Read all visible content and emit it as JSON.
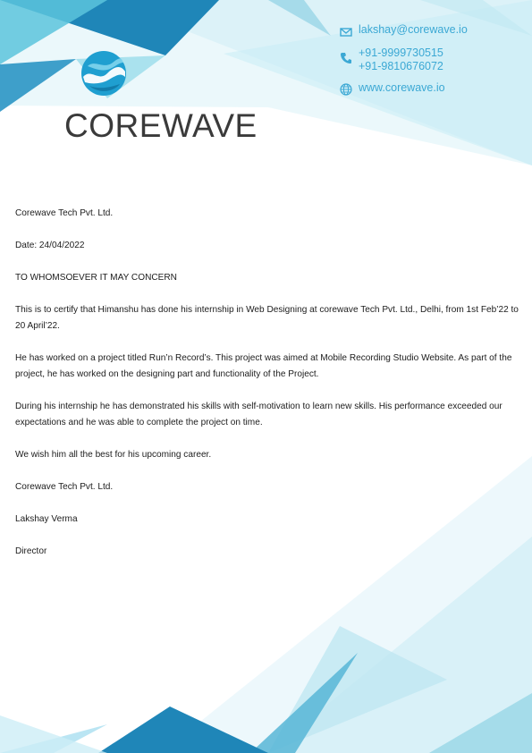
{
  "brand": {
    "name": "COREWAVE",
    "logo_icon": "wave-globe-icon",
    "accent_color": "#2aa3cf"
  },
  "contact": {
    "email": "lakshay@corewave.io",
    "phone_1": "+91-9999730515",
    "phone_2": "+91-9810676072",
    "website": "www.corewave.io",
    "icons": [
      "mail-icon",
      "phone-icon",
      "globe-icon"
    ]
  },
  "letter": {
    "company": "Corewave Tech Pvt. Ltd.",
    "date": "Date: 24/04/2022",
    "salutation": "TO WHOMSOEVER IT MAY CONCERN",
    "paragraph_1": "This is to certify that Himanshu  has done his internship in Web Designing at corewave Tech Pvt. Ltd., Delhi, from 1st Feb’22  to 20 April’22.",
    "paragraph_2": "He has worked on a project titled Run’n Record’s. This project was aimed at Mobile Recording Studio Website. As part of the project, he has worked on the designing part and functionality of the Project.",
    "paragraph_3": "During his internship he has demonstrated his skills with self-motivation to learn new skills. His performance exceeded our expectations and he was able to complete the project on time.",
    "closing": "We wish him all the best for his upcoming career.",
    "signoff_company": "Corewave Tech Pvt. Ltd.",
    "signatory_name": "Lakshay Verma",
    "signatory_title": "Director"
  }
}
